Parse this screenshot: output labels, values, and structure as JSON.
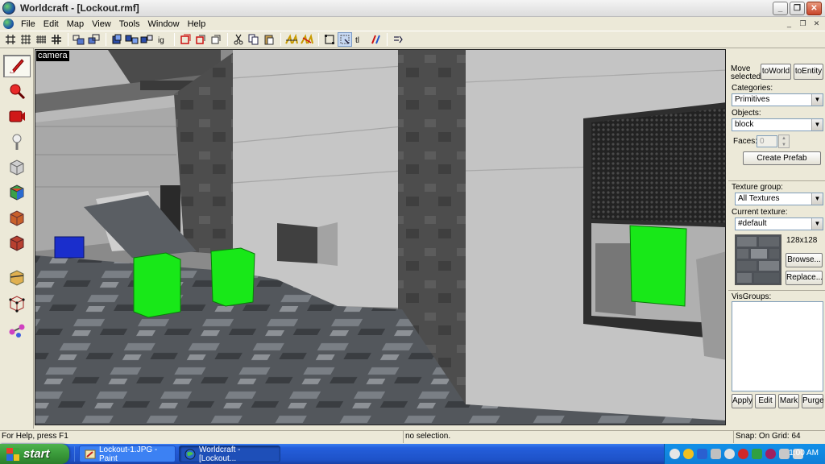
{
  "window": {
    "title": "Worldcraft - [Lockout.rmf]",
    "minimize_glyph": "_",
    "maximize_glyph": "❐",
    "close_glyph": "✕"
  },
  "menu": {
    "items": [
      "File",
      "Edit",
      "Map",
      "View",
      "Tools",
      "Window",
      "Help"
    ],
    "mdi_min": "_",
    "mdi_restore": "❐",
    "mdi_close": "✕"
  },
  "viewport": {
    "label": "camera"
  },
  "panel": {
    "move_selected_line1": "Move",
    "move_selected_line2": "selected:",
    "to_world": "toWorld",
    "to_entity": "toEntity",
    "categories_label": "Categories:",
    "categories_value": "Primitives",
    "objects_label": "Objects:",
    "objects_value": "block",
    "faces_label": "Faces:",
    "faces_value": "0",
    "create_prefab": "Create Prefab",
    "texture_group_label": "Texture group:",
    "texture_group_value": "All Textures",
    "current_texture_label": "Current texture:",
    "current_texture_value": "#default",
    "texture_size": "128x128",
    "browse": "Browse...",
    "replace": "Replace...",
    "visgroups_label": "VisGroups:",
    "apply": "Apply",
    "edit": "Edit",
    "mark": "Mark",
    "purge": "Purge"
  },
  "status": {
    "help": "For Help, press F1",
    "selection": "no selection.",
    "snap": "Snap: On Grid: 64"
  },
  "taskbar": {
    "start": "start",
    "tasks": [
      "Lockout-1.JPG - Paint",
      "Worldcraft - [Lockout..."
    ],
    "clock": "1:00 AM"
  },
  "colors": {
    "title_bar": "#e4e4e4",
    "window_bg": "#ece9d8",
    "taskbar": "#245edb",
    "start_button": "#3a9a3a",
    "tray": "#0f7fd8",
    "entity_green": "#18e818",
    "entity_blue": "#1a2ecc"
  }
}
